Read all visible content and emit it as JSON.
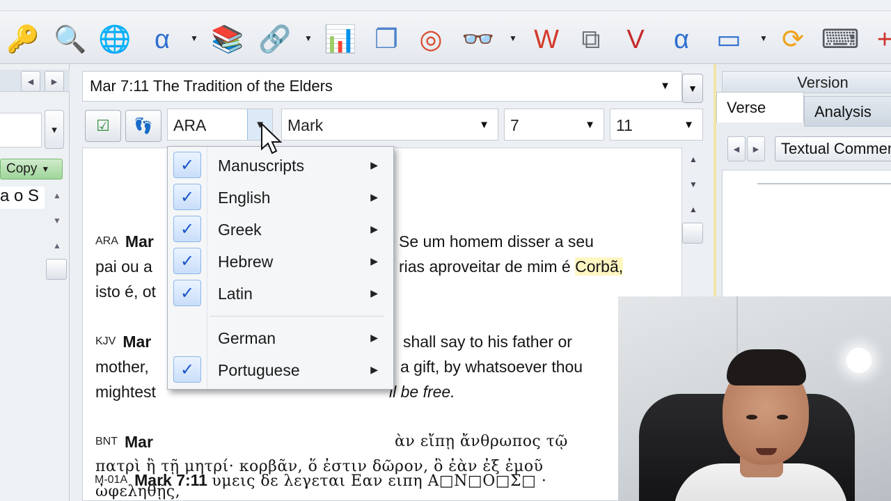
{
  "toolbar": {
    "icons": [
      {
        "name": "key-icon",
        "glyph": "🔑",
        "color": "#e8a21a"
      },
      {
        "name": "search-icon",
        "glyph": "🔍",
        "color": "#4a7fc2"
      },
      {
        "name": "globe-icon",
        "glyph": "🌐",
        "color": "#2b7fd1"
      },
      {
        "name": "alpha-book-icon",
        "glyph": "α",
        "color": "#2d6fcf"
      },
      {
        "name": "books-stack-icon",
        "glyph": "📚",
        "color": "#6b6f74"
      },
      {
        "name": "link-icon",
        "glyph": "🔗",
        "color": "#8a8f95"
      },
      {
        "name": "report-chart-icon",
        "glyph": "📊",
        "color": "#2f66c0"
      },
      {
        "name": "windows-icon",
        "glyph": "❐",
        "color": "#4d82c9"
      },
      {
        "name": "sync-circle-icon",
        "glyph": "◎",
        "color": "#d84a2b"
      },
      {
        "name": "glasses-book-icon",
        "glyph": "👓",
        "color": "#3366aa"
      },
      {
        "name": "word-doc-icon",
        "glyph": "W",
        "color": "#d33a2c"
      },
      {
        "name": "copy-doc-icon",
        "glyph": "⧉",
        "color": "#6e7378"
      },
      {
        "name": "verse-list-icon",
        "glyph": "V",
        "color": "#c62b2b"
      },
      {
        "name": "alpha-icon",
        "glyph": "α",
        "color": "#2d6fcf"
      },
      {
        "name": "bible-window-icon",
        "glyph": "▭",
        "color": "#2d6fcf"
      },
      {
        "name": "refresh-icon",
        "glyph": "⟳",
        "color": "#f0a21c"
      },
      {
        "name": "keyboard-icon",
        "glyph": "⌨",
        "color": "#555a60"
      },
      {
        "name": "add-window-icon",
        "glyph": "+",
        "color": "#d0302a"
      }
    ]
  },
  "left_pane": {
    "copy_label": "Copy",
    "snippet": "a o S"
  },
  "center": {
    "reference_title": "Mar 7:11 The Tradition of the Elders",
    "version_selected": "ARA",
    "book_selected": "Mark",
    "chapter_selected": "7",
    "verse_selected": "11",
    "verses": [
      {
        "abbr": "ARA",
        "ref": "Mar",
        "line1_end": "Se um homem disser a seu",
        "line2_start": "pai ou a",
        "line2_end_pre": "rias aproveitar de mim é ",
        "highlight": "Corbã,",
        "line3": "isto é, ot"
      },
      {
        "abbr": "KJV",
        "ref": "Mar",
        "line1_end": "shall say to his father or",
        "line2_start": "mother,",
        "line2_end": "a gift, by whatsoever thou",
        "line3_start": "mightest",
        "line3_end": "ll be free."
      },
      {
        "abbr": "BNT",
        "ref": "Mar",
        "line1_end": "ὰν εἴπῃ ἄνθρωπος τῷ",
        "line2": "πατρὶ ἢ τῇ μητρί· κορβᾶν, ὅ ἐστιν δῶρον, ὃ ἐὰν ἐξ ἐμοῦ",
        "line3": "ὠφεληθῇς,"
      },
      {
        "abbr": "M-01A",
        "ref": "Mark 7:11",
        "line1": "υμεις δε λεγεται Εαν ειπη Α□Ν□Ο□Σ□ ·"
      }
    ]
  },
  "menu": {
    "items": [
      {
        "label": "Manuscripts",
        "checked": true
      },
      {
        "label": "English",
        "checked": true
      },
      {
        "label": "Greek",
        "checked": true
      },
      {
        "label": "Hebrew",
        "checked": true
      },
      {
        "label": "Latin",
        "checked": true
      },
      {
        "label": "German",
        "checked": false
      },
      {
        "label": "Portuguese",
        "checked": true
      }
    ]
  },
  "right_pane": {
    "title": "Version",
    "tabs": [
      "Verse",
      "Analysis"
    ],
    "active_tab": "Verse",
    "textual_label": "Textual Commen"
  }
}
